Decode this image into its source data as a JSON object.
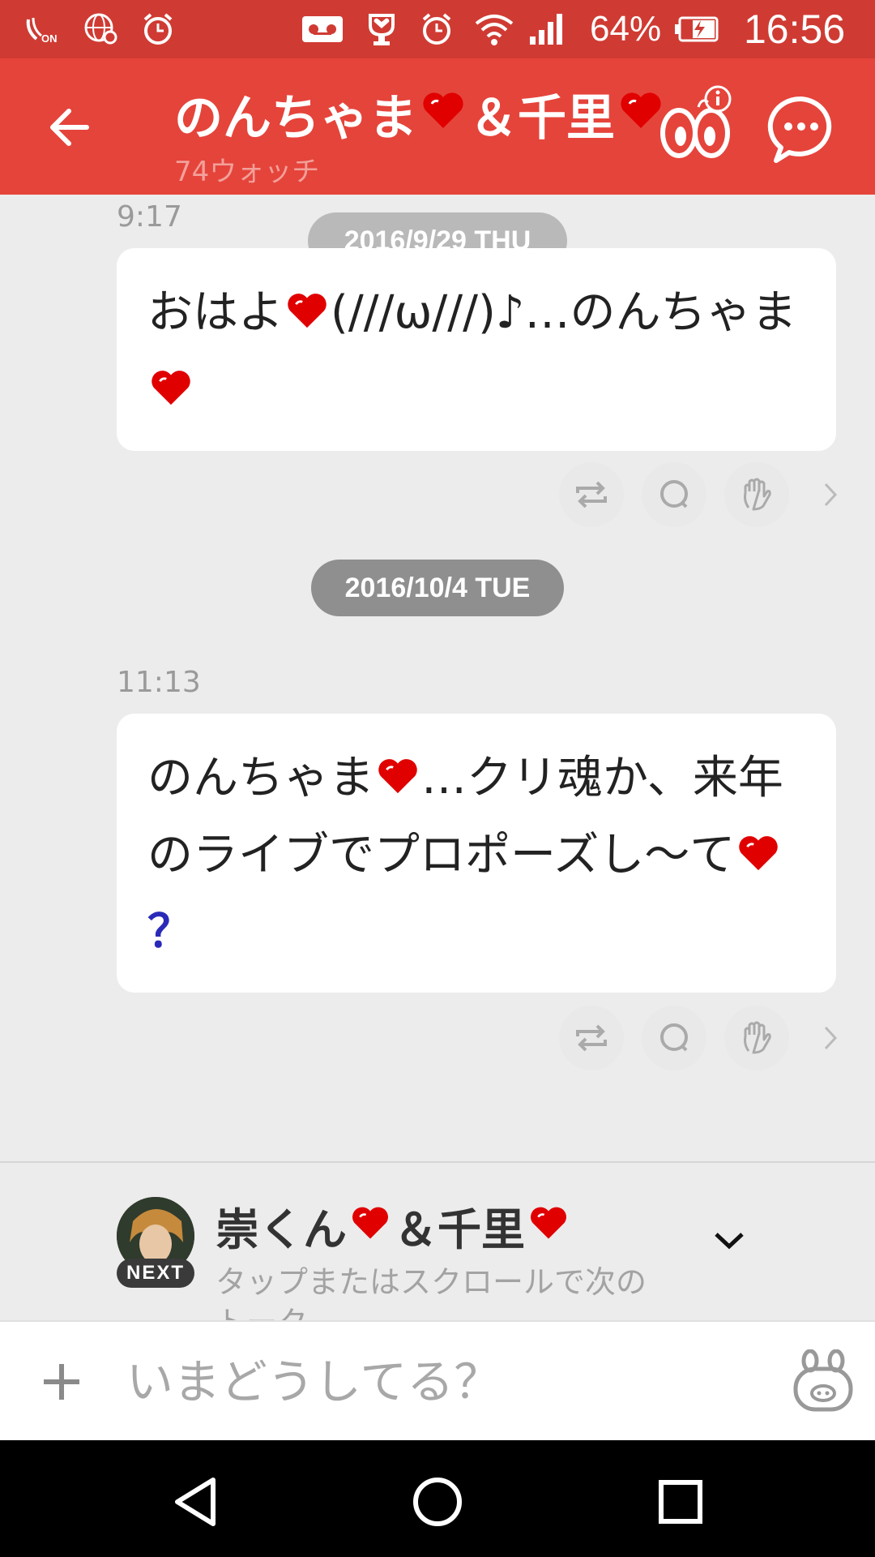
{
  "status_bar": {
    "battery": "64%",
    "time": "16:56",
    "icons": [
      "volte-icon",
      "vpn-globe-icon",
      "alarm-icon",
      "voicemail-icon",
      "heart-trophy-icon",
      "alarm-icon",
      "wifi-icon",
      "signal-icon",
      "battery-charging-icon"
    ]
  },
  "header": {
    "title_part1": "のんちゃま",
    "title_part2": "＆千里",
    "watch_count": "74ウォッチ",
    "accent_color": "#e5443b"
  },
  "feed": {
    "top_time": "9:17",
    "sticky_date": "2016/9/29 THU",
    "posts": [
      {
        "text_a": "おはよ",
        "text_b": "(///ω///)♪…のんちゃま",
        "text_c": ""
      },
      {
        "date": "2016/10/4 TUE",
        "time": "11:13",
        "text_a": "のんちゃま",
        "text_b": "…クリ魂か、来年のライブでプロポーズし〜て",
        "text_c": "？"
      }
    ]
  },
  "next": {
    "badge": "NEXT",
    "title_part1": "崇くん",
    "title_part2": "＆千里",
    "hint": "タップまたはスクロールで次のトーク"
  },
  "compose": {
    "placeholder": "いまどうしてる？"
  }
}
